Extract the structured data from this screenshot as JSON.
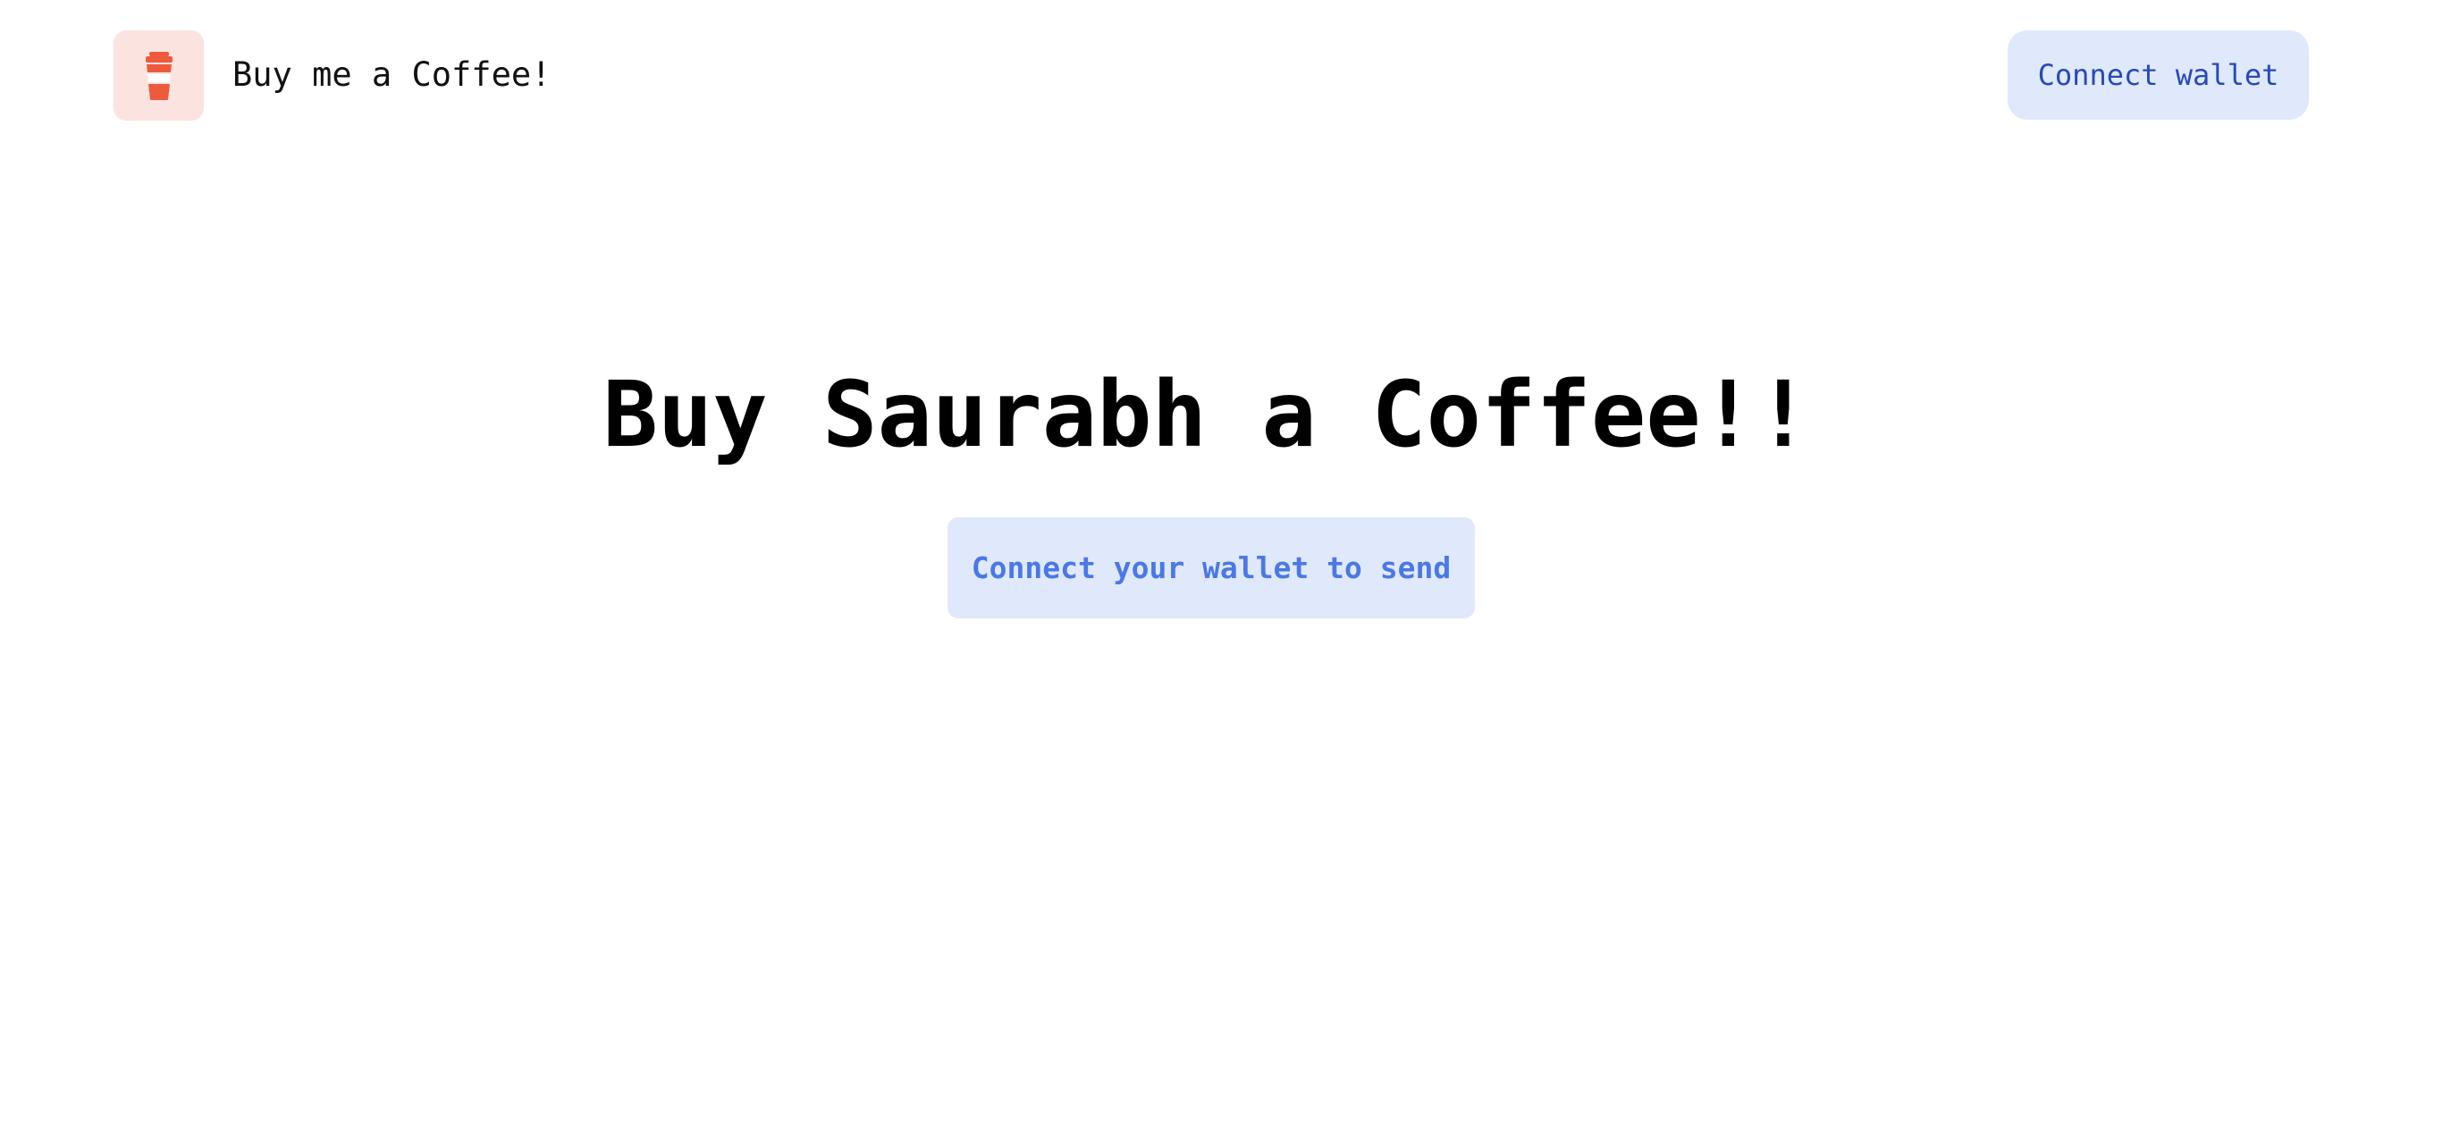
{
  "header": {
    "logo_icon": "coffee-cup-icon",
    "brand": "Buy me a Coffee!",
    "connect_wallet_label": "Connect wallet"
  },
  "hero": {
    "title": "Buy Saurabh a Coffee!!",
    "send_button_label": "Connect your wallet to send"
  },
  "colors": {
    "logo_tile_bg": "#fbe3e0",
    "logo_icon": "#ee5a3c",
    "button_bg": "#dfe9fb",
    "header_button_text": "#2749b8",
    "hero_button_text": "#4b78e6",
    "text": "#000000"
  }
}
